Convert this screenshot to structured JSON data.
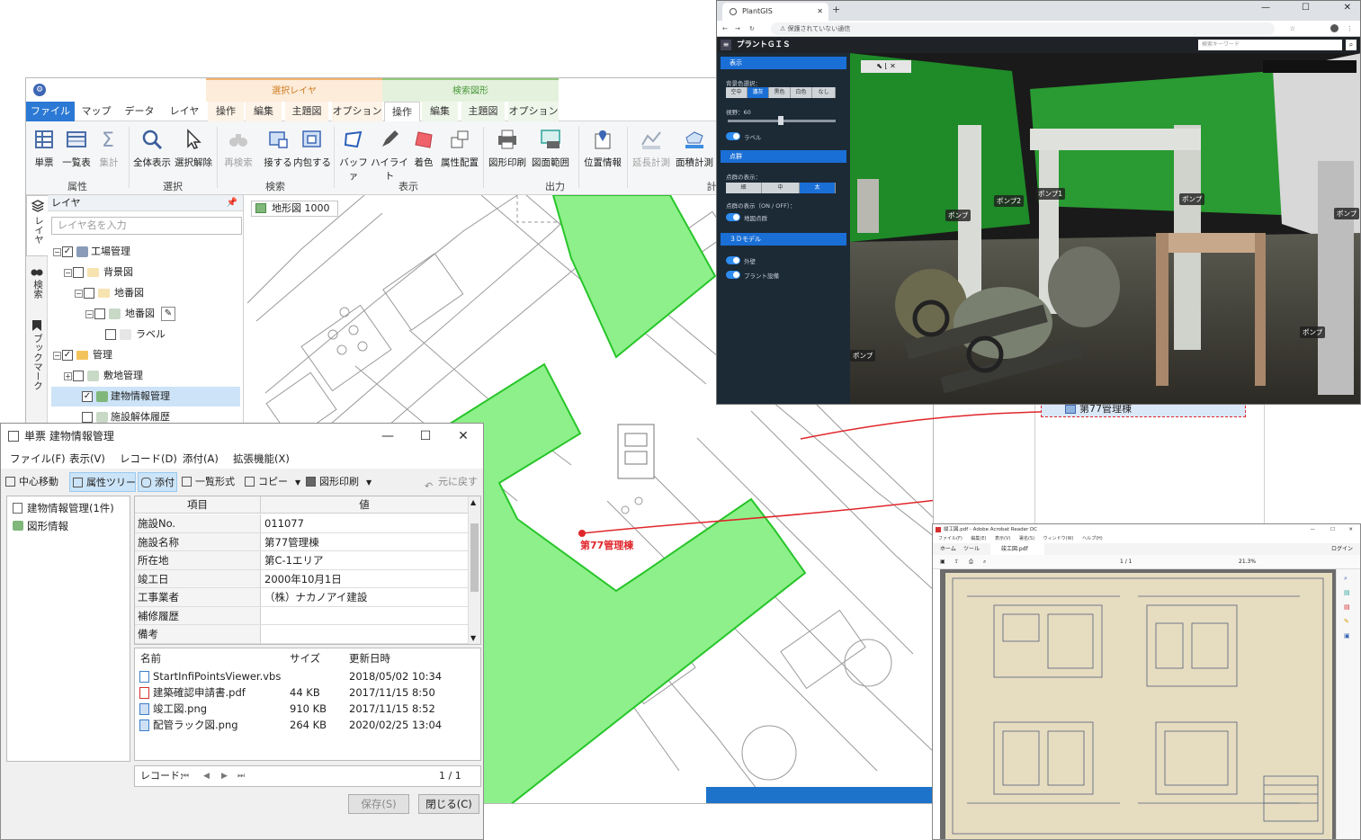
{
  "gis": {
    "context_groups": {
      "select_layer": "選択レイヤ",
      "search_shape": "検索図形"
    },
    "tabs": [
      "ファイル",
      "マップ",
      "データ",
      "レイヤ",
      "操作",
      "編集",
      "主題図",
      "オプション",
      "操作",
      "編集",
      "主題図",
      "オプション"
    ],
    "ribbon": {
      "buttons": [
        "単票",
        "一覧表",
        "集計",
        "全体表示",
        "選択解除",
        "再検索",
        "接する",
        "内包する",
        "バッファ",
        "ハイライト",
        "着色",
        "属性配置",
        "図形印刷",
        "図面範囲",
        "位置情報",
        "延長計測",
        "面積計測"
      ],
      "groups": [
        "属性",
        "選択",
        "検索",
        "表示",
        "出力",
        "計"
      ]
    },
    "side_tabs": {
      "layer": "レイヤ",
      "search": "検索",
      "bookmark": "ブックマーク"
    },
    "layer_panel": {
      "title": "レイヤ",
      "pin": "ꟷ",
      "search_placeholder": "レイヤ名を入力",
      "tree": [
        "工場管理",
        "背景図",
        "地番図",
        "地番図",
        "ラベル",
        "管理",
        "敷地管理",
        "建物情報管理",
        "施設解体履歴"
      ]
    },
    "map": {
      "scale_label": "地形図 1000",
      "building_label": "第77管理棟",
      "selected_feature": "第77管理棟",
      "highlight_color": "#8ef08a",
      "highlight_border": "#27c52a",
      "link_color": "#e0262b"
    }
  },
  "dialog": {
    "title": "単票 建物情報管理",
    "window_controls": [
      "—",
      "☐",
      "✕"
    ],
    "menu": [
      "ファイル(F)",
      "表示(V)",
      "レコード(D)",
      "添付(A)",
      "拡張機能(X)"
    ],
    "toolbar": [
      "中心移動",
      "属性ツリー",
      "添付",
      "一覧形式",
      "コピー",
      "図形印刷",
      "元に戻す"
    ],
    "tree": [
      "建物情報管理(1件)",
      "図形情報"
    ],
    "grid_headers": [
      "項目",
      "値"
    ],
    "rows": [
      {
        "k": "施設No.",
        "v": "011077"
      },
      {
        "k": "施設名称",
        "v": "第77管理棟"
      },
      {
        "k": "所在地",
        "v": "第C-1エリア"
      },
      {
        "k": "竣工日",
        "v": "2000年10月1日"
      },
      {
        "k": "工事業者",
        "v": "（株）ナカノアイ建設"
      },
      {
        "k": "補修履歴",
        "v": ""
      },
      {
        "k": "備考",
        "v": ""
      }
    ],
    "file_headers": [
      "名前",
      "サイズ",
      "更新日時"
    ],
    "files": [
      {
        "name": "StartInfiPointsViewer.vbs",
        "size": "",
        "date": "2018/05/02 10:34"
      },
      {
        "name": "建築確認申請書.pdf",
        "size": "44 KB",
        "date": "2017/11/15 8:50"
      },
      {
        "name": "竣工図.png",
        "size": "910 KB",
        "date": "2017/11/15 8:52"
      },
      {
        "name": "配管ラック図.png",
        "size": "264 KB",
        "date": "2020/02/25 13:04"
      }
    ],
    "record_label": "レコード:",
    "record_nav": [
      "⏮",
      "◀",
      "▶",
      "⏭"
    ],
    "record_count": "1 / 1",
    "save_button": "保存(S)",
    "close_button": "閉じる(C)"
  },
  "browser": {
    "tab_title": "PlantGIS",
    "new_tab": "+",
    "address": "⚠ 保護されていない通信",
    "app_title": "プラントＧＩＳ",
    "search_placeholder": "検索キーワード",
    "sections": {
      "display": "表示",
      "bg_label": "背景色選択：",
      "bg_options": [
        "空中",
        "濃灰",
        "黒色",
        "白色",
        "なし"
      ],
      "fov": "視野：60",
      "label_toggle": "ラベル",
      "pointcloud": "点群",
      "point_size": "点群の表示：",
      "point_options": [
        "細",
        "中",
        "太"
      ],
      "point_onoff": "点群の表示（ON / OFF）：",
      "point_item": "地図点群",
      "model": "３Ｄモデル",
      "model_items": [
        "外壁",
        "プラント設備"
      ]
    },
    "pump_labels": [
      "ポンプ",
      "ポンプ1",
      "ポンプ2",
      "ポンプ",
      "ポンプ",
      "ポンプ",
      "ポンプ"
    ]
  },
  "pdf": {
    "title": "竣工図.pdf - Adobe Acrobat Reader DC",
    "menu": [
      "ファイル(F)",
      "編集(E)",
      "表示(V)",
      "署名(S)",
      "ウィンドウ(W)",
      "ヘルプ(H)"
    ],
    "tabs": [
      "ホーム",
      "ツール",
      "竣工図.pdf"
    ],
    "login": "ログイン",
    "page": "1 / 1",
    "zoom": "21.3%"
  }
}
